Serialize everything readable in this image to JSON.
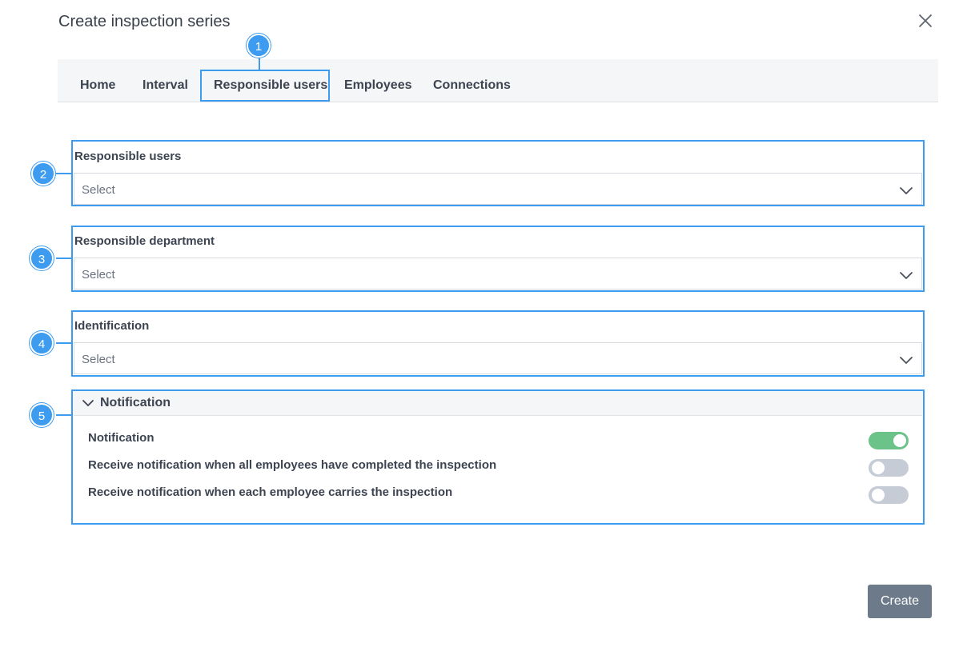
{
  "dialog": {
    "title": "Create inspection series"
  },
  "tabs": [
    {
      "label": "Home"
    },
    {
      "label": "Interval"
    },
    {
      "label": "Responsible users",
      "active": true
    },
    {
      "label": "Employees"
    },
    {
      "label": "Connections"
    }
  ],
  "fields": {
    "responsible_users": {
      "label": "Responsible users",
      "placeholder": "Select"
    },
    "responsible_department": {
      "label": "Responsible department",
      "placeholder": "Select"
    },
    "identification": {
      "label": "Identification",
      "placeholder": "Select"
    }
  },
  "notification": {
    "section_title": "Notification",
    "rows": [
      {
        "label": "Notification",
        "enabled": true
      },
      {
        "label": "Receive notification when all employees have completed the inspection",
        "enabled": false
      },
      {
        "label": "Receive notification when each employee carries the inspection",
        "enabled": false
      }
    ]
  },
  "callouts": [
    "1",
    "2",
    "3",
    "4",
    "5"
  ],
  "footer": {
    "create_label": "Create"
  },
  "icons": {
    "close": "close-icon",
    "dropdown": "chevron-down-icon",
    "collapse": "chevron-down-icon"
  },
  "colors": {
    "highlight": "#3d9cf0",
    "toggle_on": "#6cc389",
    "toggle_off": "#c5ccd6",
    "create_button": "#6c7a8a"
  }
}
